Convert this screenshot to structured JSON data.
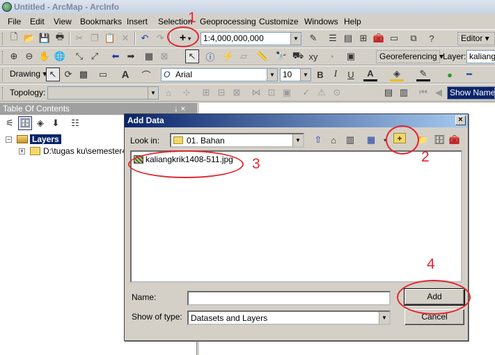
{
  "window": {
    "title": "Untitled - ArcMap - ArcInfo"
  },
  "menu": [
    "File",
    "Edit",
    "View",
    "Bookmarks",
    "Insert",
    "Selection",
    "Geoprocessing",
    "Customize",
    "Windows",
    "Help"
  ],
  "toolbar1": {
    "scale": "1:4,000,000,000",
    "editor_label": "Editor ▾"
  },
  "toolbar2": {
    "georeferencing_label": "Georeferencing ▾",
    "layer_label": "Layer:",
    "layer_value": "kaliangk"
  },
  "toolbar3": {
    "drawing_label": "Drawing ▾",
    "font": "Arial",
    "font_size": "10",
    "bold": "B",
    "italic": "I",
    "underline": "U"
  },
  "toolbar4": {
    "topology_label": "Topology:",
    "show_name": "Show Name"
  },
  "toc": {
    "header": "Table Of Contents",
    "pin": "↓ ×",
    "root": "Layers",
    "path": "D:\\tugas ku\\semester4\\"
  },
  "dialog": {
    "title": "Add Data",
    "close": "×",
    "look_in_label": "Look in:",
    "look_in_value": "01. Bahan",
    "files": [
      "kaliangkrik1408-511.jpg"
    ],
    "name_label": "Name:",
    "name_value": "",
    "type_label": "Show of type:",
    "type_value": "Datasets and Layers",
    "add_button": "Add",
    "cancel_button": "Cancel"
  },
  "annotations": [
    "1",
    "2",
    "3",
    "4"
  ]
}
